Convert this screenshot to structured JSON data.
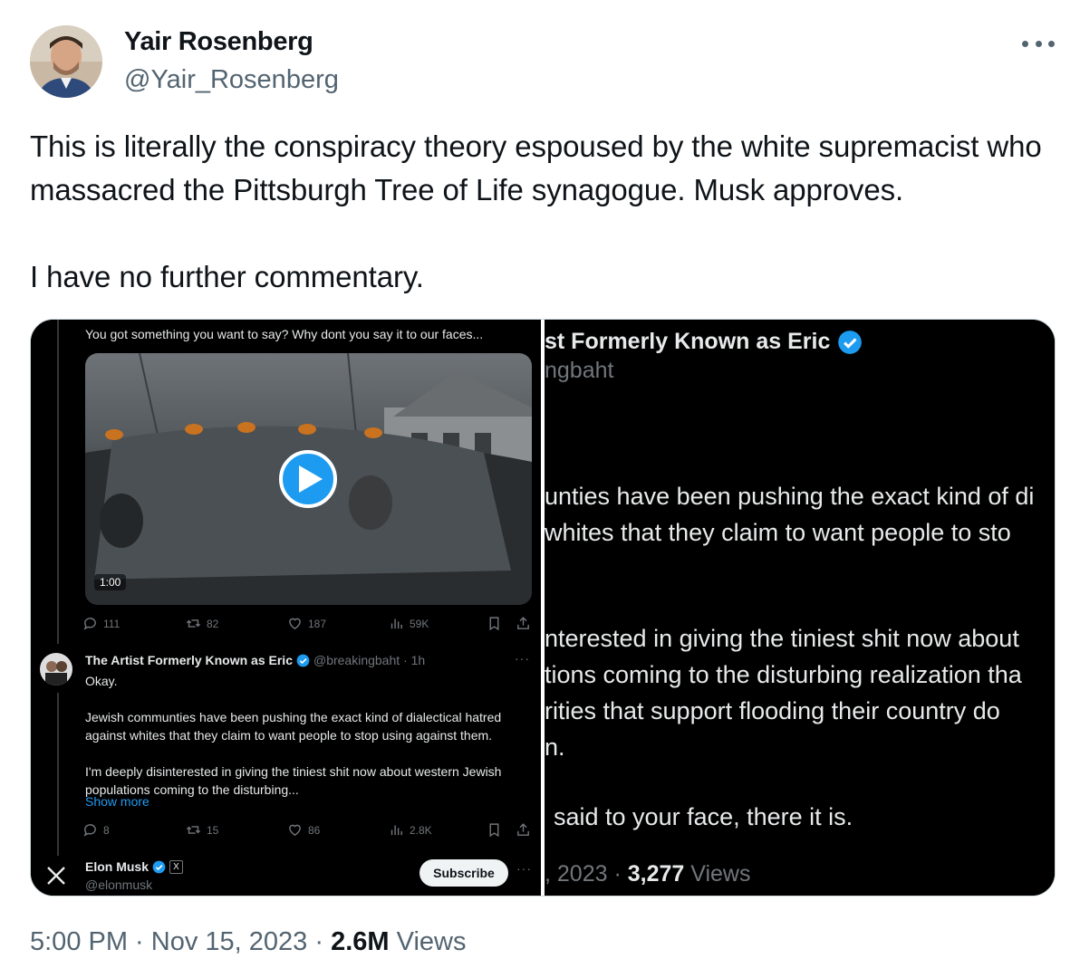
{
  "tweet": {
    "author_name": "Yair Rosenberg",
    "author_handle": "@Yair_Rosenberg",
    "text": "This is literally the conspiracy theory espoused by the white supremacist who massacred the Pittsburgh Tree of Life synagogue. Musk approves.\n\nI have no further commentary.",
    "time": "5:00 PM",
    "date": "Nov 15, 2023",
    "views_count": "2.6M",
    "views_label": "Views"
  },
  "left_panel": {
    "prev_text": "You got something you want to say? Why dont you say it to our faces...",
    "video_duration": "1:00",
    "video_stats": {
      "replies": "111",
      "reposts": "82",
      "likes": "187",
      "views": "59K"
    },
    "reply": {
      "name": "The Artist Formerly Known as Eric",
      "handle_time": "@breakingbaht · 1h",
      "body": "Okay.\n\nJewish communties have been pushing the exact kind of dialectical hatred against whites that they claim to want people to stop using against them.\n\nI'm deeply disinterested in giving the tiniest shit now about western Jewish populations coming to the disturbing...",
      "show_more": "Show more",
      "stats": {
        "replies": "8",
        "reposts": "15",
        "likes": "86",
        "views": "2.8K"
      }
    },
    "elon": {
      "name": "Elon Musk",
      "badge": "X",
      "handle": "@elonmusk",
      "subscribe_label": "Subscribe"
    }
  },
  "right_panel": {
    "name_fragment": "st Formerly Known as Eric",
    "handle_fragment": "ngbaht",
    "lines": [
      "unties have been pushing the exact kind of di",
      " whites that they claim to want people to sto",
      "nterested in giving the tiniest shit now about",
      "tions coming to the disturbing realization tha",
      "rities that support flooding their country do",
      "n.",
      "said to your face, there it is."
    ],
    "footer_date": ", 2023 ·",
    "footer_views_count": "3,277",
    "footer_views_label": "Views"
  },
  "colors": {
    "accent": "#1d9bf0",
    "text_primary": "#0f1419",
    "text_secondary": "#536471",
    "dark_bg": "#000000",
    "dark_text": "#e7e9ea",
    "dark_muted": "#71767b"
  },
  "icons": [
    "more-horizontal-icon",
    "play-icon",
    "reply-icon",
    "repost-icon",
    "like-icon",
    "views-icon",
    "bookmark-icon",
    "share-icon",
    "verified-badge-icon",
    "x-logo-icon"
  ]
}
